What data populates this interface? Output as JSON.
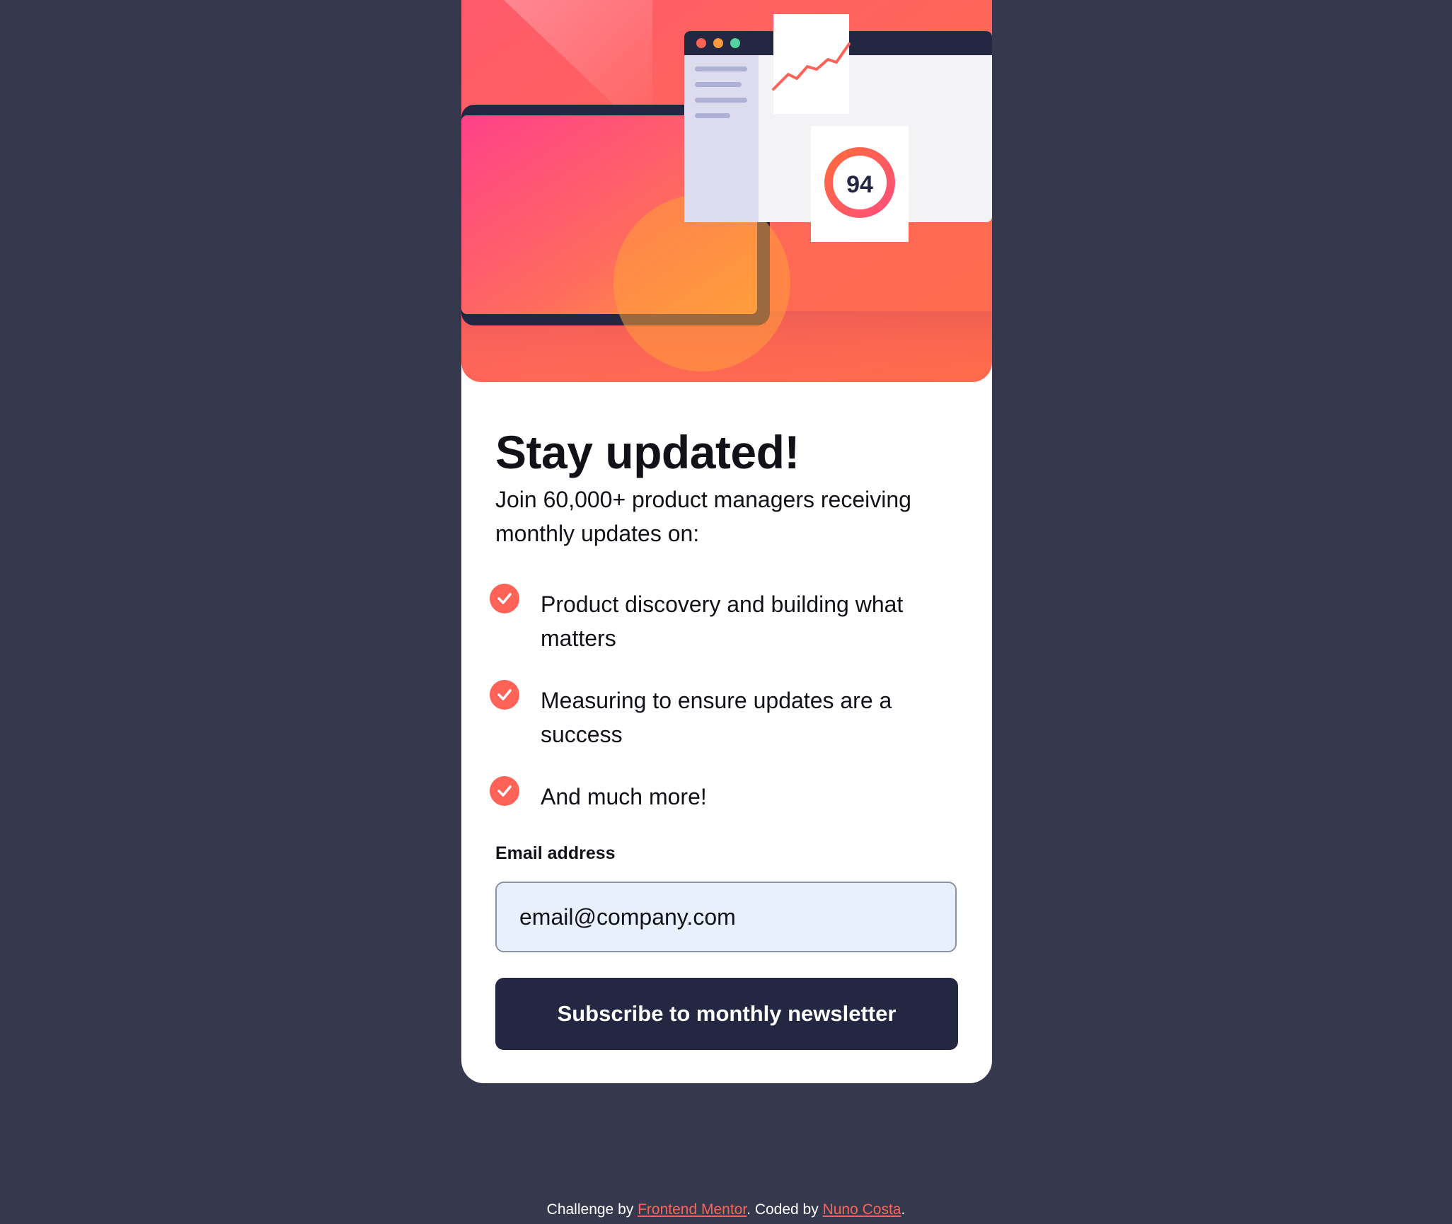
{
  "card": {
    "title": "Stay updated!",
    "intro": "Join 60,000+ product managers receiving monthly updates on:",
    "illustration": {
      "score": "94"
    },
    "features": [
      "Product discovery and building what matters",
      "Measuring to ensure updates are a success",
      "And much more!"
    ],
    "form": {
      "email_label": "Email address",
      "email_placeholder": "email@company.com",
      "submit_label": "Subscribe to monthly newsletter"
    }
  },
  "footer": {
    "prefix": "Challenge by ",
    "link1": "Frontend Mentor",
    "middle": ". Coded by ",
    "link2": "Nuno Costa",
    "suffix": "."
  },
  "colors": {
    "page_background": "#36384e",
    "card_background": "#ffffff",
    "accent": "#ff6257",
    "button": "#242742",
    "input_background": "#e8f0fe"
  },
  "icons": {
    "feature_bullet": "check-circle-icon"
  }
}
